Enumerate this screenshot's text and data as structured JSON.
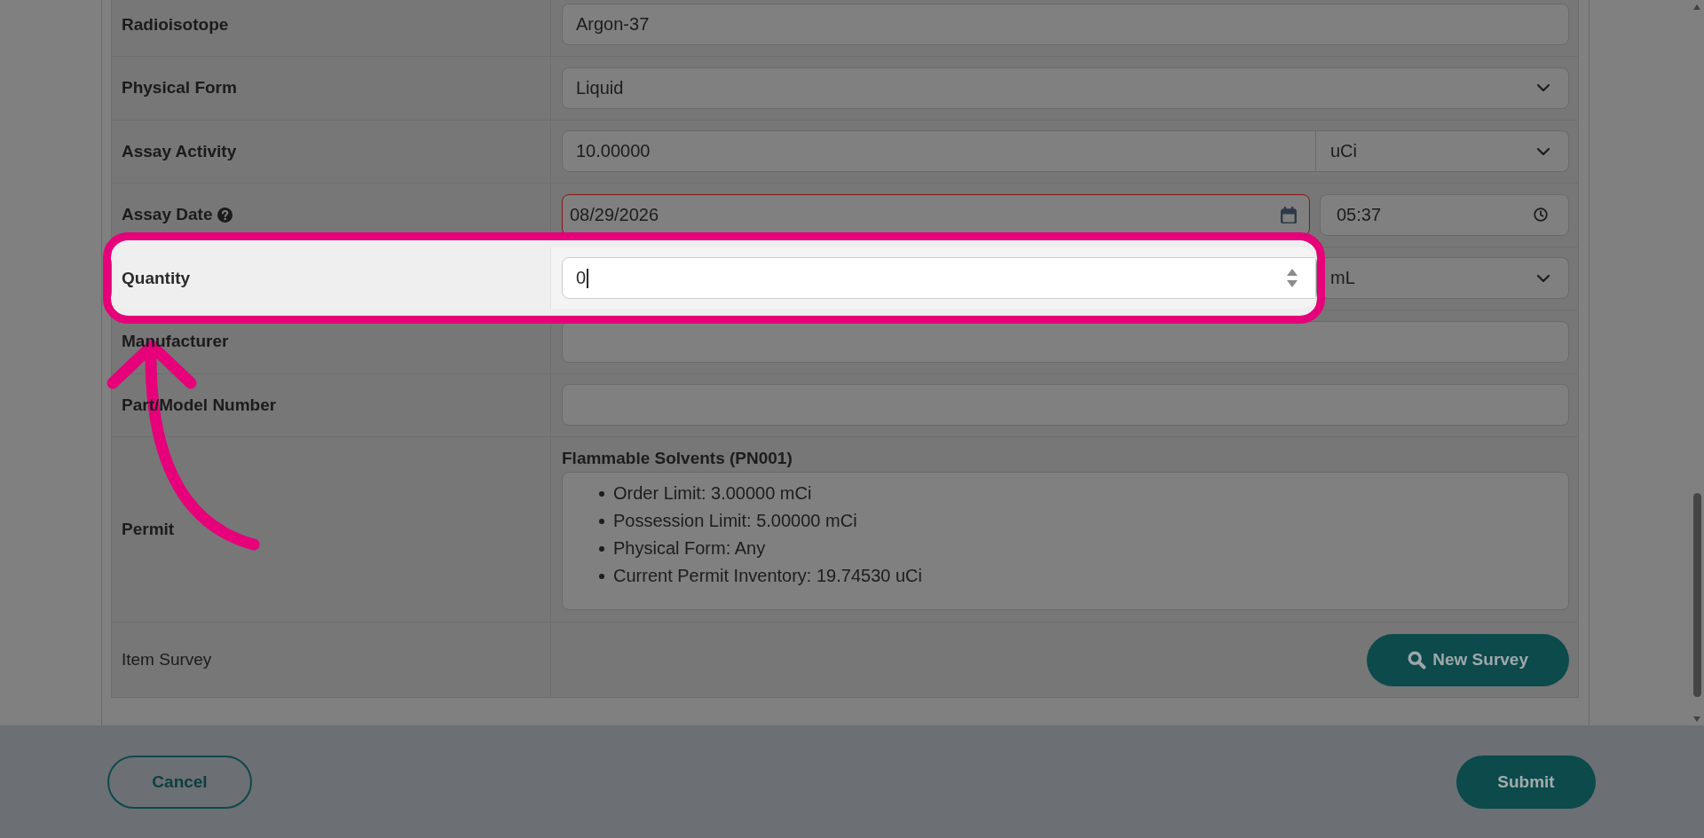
{
  "form": {
    "rows": [
      {
        "label": "Radioisotope",
        "required": true,
        "help": false,
        "highlighted": false,
        "kind": "text",
        "value": "Argon-37",
        "focused": false
      },
      {
        "label": "Physical Form",
        "required": true,
        "help": false,
        "highlighted": false,
        "kind": "select",
        "value": "Liquid",
        "focused": false
      },
      {
        "label": "Assay Activity",
        "required": true,
        "help": false,
        "highlighted": false,
        "kind": "number_unit",
        "value": "10.00000",
        "unit": "uCi",
        "focused": false
      },
      {
        "label": "Assay Date",
        "required": true,
        "help": true,
        "highlighted": false,
        "kind": "datetime",
        "date": {
          "value": "08/29/2026",
          "invalid": true
        },
        "time": {
          "value": "05:37",
          "invalid": false
        }
      },
      {
        "label": "Quantity",
        "required": true,
        "help": false,
        "highlighted": true,
        "kind": "number_unit",
        "value": "0",
        "unit": "mL",
        "focused": true
      },
      {
        "label": "Manufacturer",
        "required": true,
        "help": false,
        "highlighted": false,
        "kind": "text",
        "focused": false
      },
      {
        "label": "Part/Model Number",
        "required": true,
        "help": false,
        "highlighted": false,
        "kind": "text",
        "focused": false
      },
      {
        "label": "Permit",
        "required": true,
        "help": false,
        "highlighted": false,
        "kind": "permit",
        "permit": {
          "title": "Flammable Solvents (PN001)",
          "items": [
            "Order Limit: 3.00000 mCi",
            "Possession Limit: 5.00000 mCi",
            "Physical Form: Any",
            "Current Permit Inventory: 19.74530 uCi"
          ]
        }
      },
      {
        "label": "Item Survey",
        "required": false,
        "help": false,
        "highlighted": false,
        "kind": "action",
        "button": "New Survey"
      }
    ]
  },
  "footer": {
    "buttons": [
      {
        "label": "Cancel",
        "kind": "outline"
      },
      {
        "label": "Submit",
        "kind": "filled"
      }
    ]
  }
}
